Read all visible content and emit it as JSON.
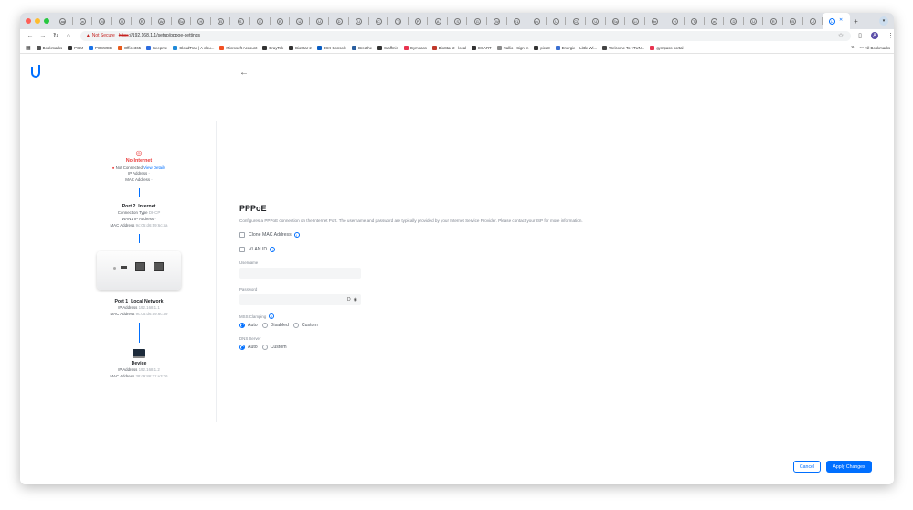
{
  "tabs": {
    "favicons": [
      "aa",
      "w",
      "M",
      "U",
      "R",
      "Ar",
      "Sc",
      "H",
      "El",
      "S",
      "E",
      "B",
      "U",
      "U",
      "D",
      "U",
      "C",
      "Tl",
      "Pl",
      "A",
      "S",
      "G",
      "W",
      "(1",
      "m",
      "U",
      "Cl",
      "U",
      "Sc",
      "Li",
      "br",
      "H",
      "Tl",
      "w",
      "D",
      "U",
      "R",
      "B",
      "U"
    ],
    "active_label": "U",
    "new_tab": "+",
    "menu": "▾"
  },
  "toolbar": {
    "security_label": "Not Secure",
    "url_scheme": "https",
    "url_rest": "://192.168.1.1/setup/pppoe-settings",
    "profile_initial": "A"
  },
  "bookmarks": {
    "items": [
      {
        "label": "Bookmarks",
        "icon": "star-icon",
        "color": "#555555"
      },
      {
        "label": "PGM",
        "icon": "globe-icon",
        "color": "#333333"
      },
      {
        "label": "POSWEB",
        "icon": "globe-icon",
        "color": "#1a73e8"
      },
      {
        "label": "Office365",
        "icon": "office-icon",
        "color": "#e85b1c"
      },
      {
        "label": "Keepme",
        "icon": "keepme-icon",
        "color": "#2d6cdf"
      },
      {
        "label": "CloudTrax | A clou...",
        "icon": "cloud-icon",
        "color": "#1f8ad8"
      },
      {
        "label": "Microsoft Account",
        "icon": "microsoft-icon",
        "color": "#f25022"
      },
      {
        "label": "DrayTek",
        "icon": "globe-icon",
        "color": "#333333"
      },
      {
        "label": "BioStar 2",
        "icon": "globe-icon",
        "color": "#333333"
      },
      {
        "label": "3CX Console",
        "icon": "3cx-icon",
        "color": "#0a5dc2"
      },
      {
        "label": "Breathe",
        "icon": "breathe-icon",
        "color": "#2a5fa0"
      },
      {
        "label": "Staffmis",
        "icon": "globe-icon",
        "color": "#333333"
      },
      {
        "label": "Gympass",
        "icon": "gympass-icon",
        "color": "#e8334f"
      },
      {
        "label": "BioStar 2 - local",
        "icon": "biostar-icon",
        "color": "#c0392b"
      },
      {
        "label": "ECART",
        "icon": "globe-icon",
        "color": "#333333"
      },
      {
        "label": "Rallio - Sign in",
        "icon": "rallio-icon",
        "color": "#8a8a8a"
      },
      {
        "label": "pica8",
        "icon": "globe-icon",
        "color": "#333333"
      },
      {
        "label": "Energie – Little Wi...",
        "icon": "energie-icon",
        "color": "#3b6fd1"
      },
      {
        "label": "Welcome To vTUN...",
        "icon": "vtun-icon",
        "color": "#444444"
      },
      {
        "label": "gympass portal",
        "icon": "gympass-icon",
        "color": "#e8334f"
      }
    ],
    "overflow": "»",
    "all_bookmarks": "All Bookmarks"
  },
  "topology": {
    "internet": {
      "status": "No Internet",
      "not_connected": "Not Connected",
      "view_details": "View Details",
      "ip_label": "IP Address",
      "ip_value": "-",
      "mac_label": "MAC Address",
      "mac_value": "-"
    },
    "port2": {
      "title": "Port 2",
      "name": "Internet",
      "conn_label": "Connection Type",
      "conn_value": "DHCP",
      "wan_label": "WAN1 IP Address",
      "wan_value": "-",
      "mac_label": "MAC Address",
      "mac_value": "9c:05:d6:59:6c:aa"
    },
    "port1": {
      "title": "Port 1",
      "name": "Local Network",
      "ip_label": "IP Address",
      "ip_value": "192.168.1.1",
      "mac_label": "MAC Address",
      "mac_value": "9c:05:d6:59:6c:a9"
    },
    "device": {
      "title": "Device",
      "ip_label": "IP Address",
      "ip_value": "192.168.1.2",
      "mac_label": "MAC Address",
      "mac_value": "38:c9:86:31:e3:26"
    }
  },
  "form": {
    "title": "PPPoE",
    "description": "Configures a PPPoE connection on the Internet Port. The username and password are typically provided by your Internet Service Provider. Please contact your ISP for more information.",
    "clone_mac": "Clone MAC Address",
    "vlan_id": "VLAN ID",
    "username_label": "Username",
    "username_value": "",
    "password_label": "Password",
    "password_value": "",
    "mss_label": "MSS Clamping",
    "mss_options": [
      "Auto",
      "Disabled",
      "Custom"
    ],
    "mss_selected": "Auto",
    "dns_label": "DNS Server",
    "dns_options": [
      "Auto",
      "Custom"
    ],
    "dns_selected": "Auto"
  },
  "actions": {
    "cancel": "Cancel",
    "apply": "Apply Changes"
  },
  "colors": {
    "accent": "#006fff",
    "error": "#ea3c3c"
  }
}
